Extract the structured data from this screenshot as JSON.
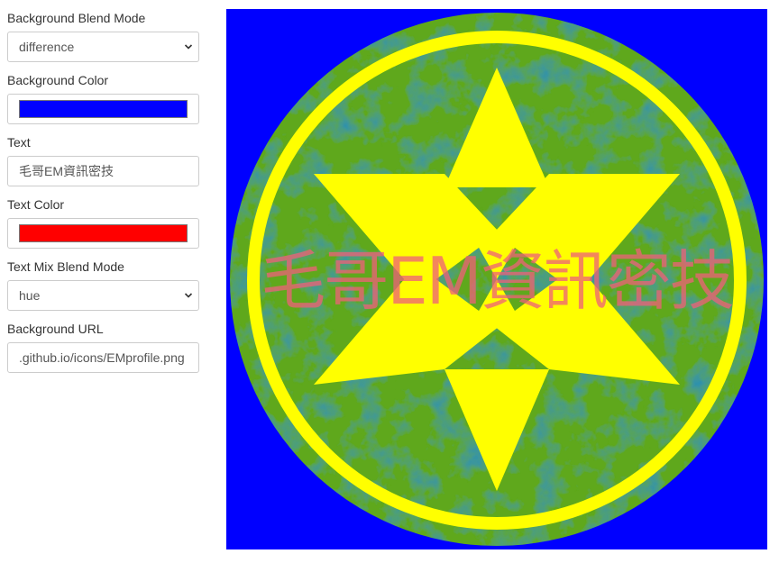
{
  "controls": {
    "bg_blend_mode": {
      "label": "Background Blend Mode",
      "value": "difference"
    },
    "bg_color": {
      "label": "Background Color",
      "value": "#0000ff"
    },
    "text": {
      "label": "Text",
      "value": "毛哥EM資訊密技"
    },
    "text_color": {
      "label": "Text Color",
      "value": "#ff0000"
    },
    "text_mix_blend_mode": {
      "label": "Text Mix Blend Mode",
      "value": "hue"
    },
    "bg_url": {
      "label": "Background URL",
      "value": ".github.io/icons/EMprofile.png"
    }
  },
  "preview": {
    "text": "毛哥EM資訊密技",
    "colors": {
      "background": "#0000ff",
      "disc": "#5fa81c",
      "ring": "#ffff00",
      "star": "#ffff00",
      "text_rendered": "#f0607a"
    }
  },
  "icons": {
    "select_arrow": "chevron-down-icon"
  }
}
